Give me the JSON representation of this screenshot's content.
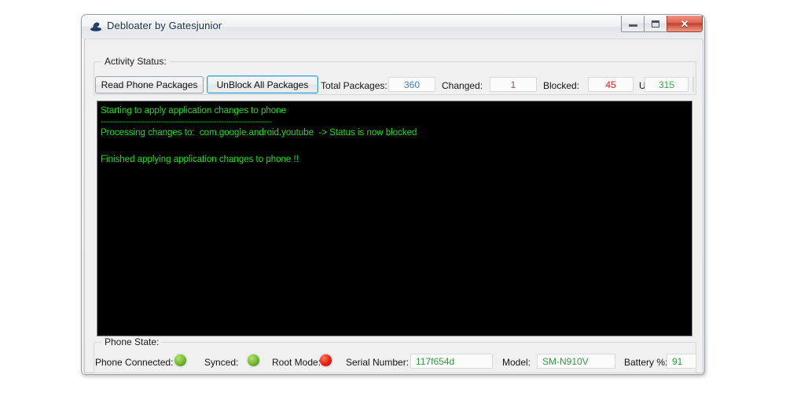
{
  "window": {
    "title": "Debloater by Gatesjunior",
    "icon": "app-hat-icon",
    "buttons": {
      "minimize": "minimize-icon",
      "maximize": "maximize-icon",
      "close": "✕"
    }
  },
  "activity_group": {
    "label": "Activity Status:",
    "read_button": "Read Phone Packages",
    "unblock_button": "UnBlock All Packages",
    "stats": [
      {
        "label": "Total Packages:",
        "value": "360",
        "color": "#4a7fc0"
      },
      {
        "label": "Changed:",
        "value": "1",
        "color": "#8a4a9c"
      },
      {
        "label": "Blocked:",
        "value": "45",
        "color": "#e01b1b"
      },
      {
        "label": "UnBlocked:",
        "value": "315",
        "color": "#3aa84a"
      }
    ]
  },
  "console": {
    "background": "#000000",
    "text_color": "#14e614",
    "lines": [
      "Starting to apply application changes to phone",
      "-----------------------------------------------------------------------",
      "Processing changes to:  com.google.android.youtube  -> Status is now blocked",
      "",
      "Finished applying application changes to phone !!"
    ]
  },
  "phone_group": {
    "label": "Phone State:",
    "connected_label": "Phone Connected:",
    "connected_state": "green",
    "synced_label": "Synced:",
    "synced_state": "green",
    "root_label": "Root Mode:",
    "root_state": "red",
    "serial_label": "Serial Number:",
    "serial_value": "117f654d",
    "model_label": "Model:",
    "model_value": "SM-N910V",
    "battery_label": "Battery %:",
    "battery_value": "91"
  }
}
